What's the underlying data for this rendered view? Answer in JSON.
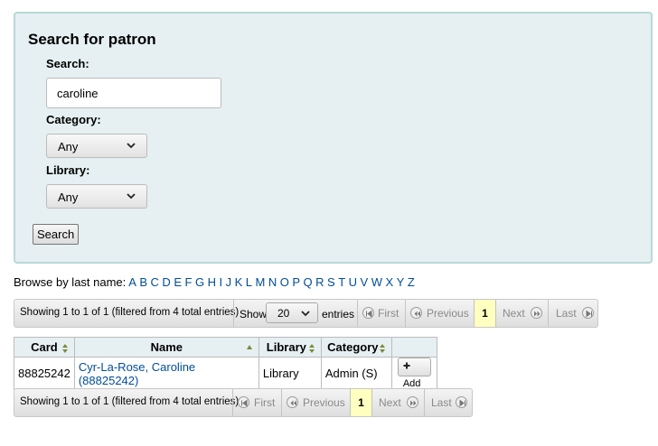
{
  "search_form": {
    "title": "Search for patron",
    "search_label": "Search:",
    "search_value": "caroline",
    "category_label": "Category:",
    "category_selected": "Any",
    "library_label": "Library:",
    "library_selected": "Any",
    "submit_label": "Search"
  },
  "browse": {
    "label": "Browse by last name:",
    "letters": [
      "A",
      "B",
      "C",
      "D",
      "E",
      "F",
      "G",
      "H",
      "I",
      "J",
      "K",
      "L",
      "M",
      "N",
      "O",
      "P",
      "Q",
      "R",
      "S",
      "T",
      "U",
      "V",
      "W",
      "X",
      "Y",
      "Z"
    ]
  },
  "table_controls": {
    "info": "Showing 1 to 1 of 1 (filtered from 4 total entries)",
    "show_label": "Show",
    "page_length": "20",
    "entries_label": "entries",
    "first": "First",
    "previous": "Previous",
    "current_page": "1",
    "next": "Next",
    "last": "Last"
  },
  "results": {
    "columns": [
      "Card",
      "Name",
      "Library",
      "Category",
      ""
    ],
    "rows": [
      {
        "card": "88825242",
        "name": "Cyr-La-Rose, Caroline (88825242)",
        "library": "Library",
        "category": "Admin (S)",
        "action": "Add"
      }
    ]
  }
}
